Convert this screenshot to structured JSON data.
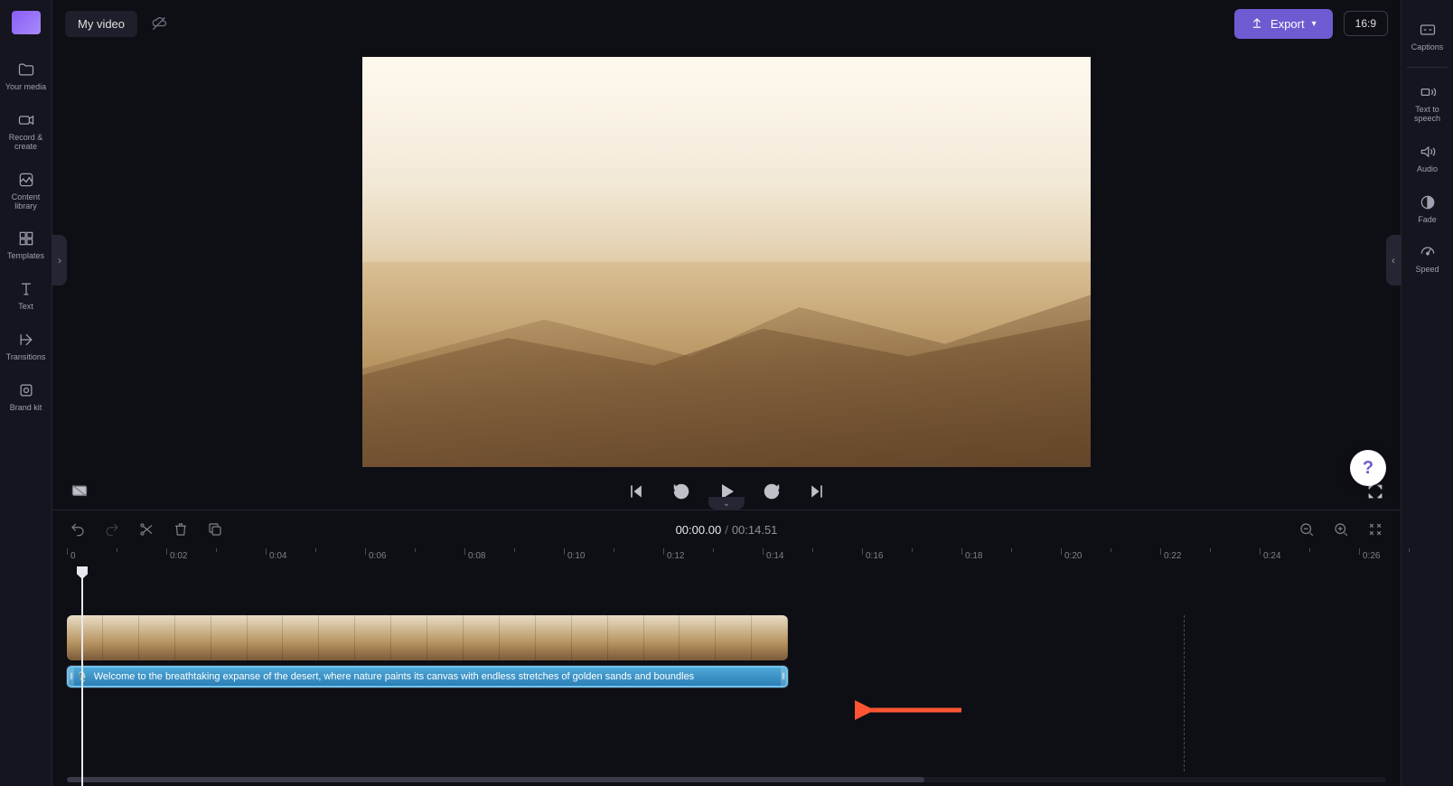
{
  "header": {
    "video_name": "My video",
    "export_label": "Export",
    "aspect_ratio": "16:9"
  },
  "left_nav": [
    {
      "label": "Your media"
    },
    {
      "label": "Record &\ncreate"
    },
    {
      "label": "Content\nlibrary"
    },
    {
      "label": "Templates"
    },
    {
      "label": "Text"
    },
    {
      "label": "Transitions"
    },
    {
      "label": "Brand kit"
    }
  ],
  "right_nav": [
    {
      "label": "Captions"
    },
    {
      "label": "Text to\nspeech"
    },
    {
      "label": "Audio"
    },
    {
      "label": "Fade"
    },
    {
      "label": "Speed"
    }
  ],
  "playback": {
    "current_time": "00:00.00",
    "total_time": "00:14.51"
  },
  "ruler": {
    "marks": [
      "0",
      "0:02",
      "0:04",
      "0:06",
      "0:08",
      "0:10",
      "0:12",
      "0:14",
      "0:16",
      "0:18",
      "0:20",
      "0:22",
      "0:24",
      "0:26"
    ]
  },
  "audio_clip": {
    "text": "Welcome to the breathtaking expanse of the desert, where nature paints its canvas with endless stretches of golden sands and boundles"
  }
}
